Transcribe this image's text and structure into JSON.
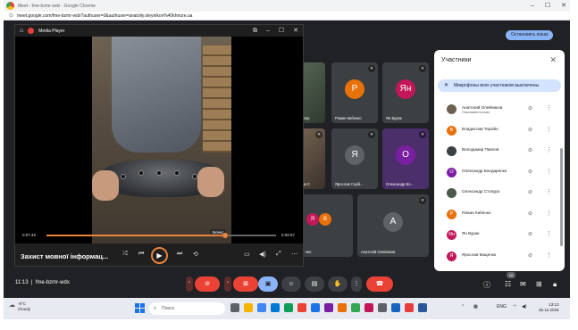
{
  "browser": {
    "window_title": "Meet - fme-bzmr-wdx - Google Chrome",
    "url": "meet.google.com/fme-bzmr-wdx?authuser=0&authuser=anatoliy.oleynikov%40khnure.ua",
    "controls": [
      "–",
      "☐",
      "✕"
    ]
  },
  "meet": {
    "present_button": "Остановить показ",
    "meeting_time": "11:13",
    "meeting_code": "fme-bzmr-wdx",
    "people_badge": "10",
    "tiles": [
      {
        "name": "Денис Бер",
        "avatar": "",
        "color": "#5a6a5a",
        "kind": "photo"
      },
      {
        "name": "Роман Кибенко",
        "avatar": "Р",
        "color": "#e8710a"
      },
      {
        "name": "Ян Бурик",
        "avatar": "Ян",
        "color": "#c2185b"
      },
      {
        "name": "Ярослав С",
        "avatar": "",
        "color": "#4a5a4a",
        "kind": "photo2"
      },
      {
        "name": "Ярослав Скубі...",
        "avatar": "Я",
        "color": "#5f6368"
      },
      {
        "name": "Олександр Бо...",
        "avatar": "О",
        "color": "#7b1fa2"
      },
      {
        "name": "Вадій 2 чел.",
        "avatar": "Я",
        "color": "#c2185b"
      },
      {
        "name": "Анатолій Олейніков",
        "avatar": "А",
        "color": "#5f6368"
      }
    ]
  },
  "player": {
    "app_name": "Media Player",
    "title": "Захист мовної інформац...",
    "time_elapsed": "0:07:46",
    "time_total": "0:09:57",
    "progress": 0.78,
    "tooltip": "Блекс"
  },
  "participants": {
    "header": "Участники",
    "mute_all_label": "Микрофоны всех участников выключены",
    "items": [
      {
        "name": "Анатолий Олейников",
        "sub": "Показывается вам",
        "avatar": "",
        "color": "#6d6252"
      },
      {
        "name": "Владислав Терзійн",
        "sub": "",
        "avatar": "В",
        "color": "#e8710a"
      },
      {
        "name": "Володимир Павлов",
        "sub": "",
        "avatar": "",
        "color": "#3c4043"
      },
      {
        "name": "Олександр Бондаренко",
        "sub": "",
        "avatar": "О",
        "color": "#7b1fa2"
      },
      {
        "name": "Олександр Стопуро",
        "sub": "",
        "avatar": "",
        "color": "#4a5a4a"
      },
      {
        "name": "Роман Кибенко",
        "sub": "",
        "avatar": "Р",
        "color": "#e8710a"
      },
      {
        "name": "Ян Бурик",
        "sub": "",
        "avatar": "Ян",
        "color": "#c2185b"
      },
      {
        "name": "Ярослав Кищенко",
        "sub": "",
        "avatar": "Я",
        "color": "#c2185b"
      },
      {
        "name": "Ярослав Скубій",
        "sub": "",
        "avatar": "",
        "color": "#5f6368"
      }
    ]
  },
  "taskbar": {
    "temp": "-8°C",
    "weather": "Cloudy",
    "search_placeholder": "Поиск",
    "lang": "ENG",
    "time": "13:13",
    "date": "25.12.2025"
  }
}
